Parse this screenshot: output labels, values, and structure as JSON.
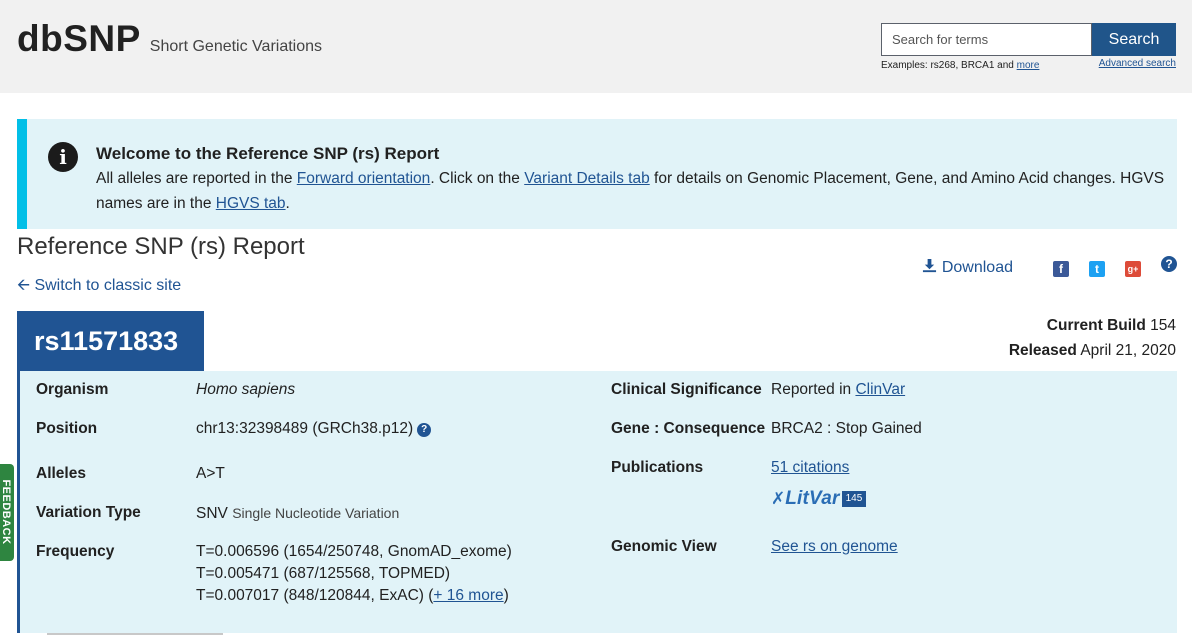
{
  "header": {
    "title": "dbSNP",
    "subtitle": "Short Genetic Variations",
    "search_placeholder": "Search for terms",
    "search_button": "Search",
    "examples_prefix": "Examples: rs268, BRCA1 and ",
    "examples_more": "more",
    "advanced_search": "Advanced search"
  },
  "banner": {
    "title": "Welcome to the Reference SNP (rs) Report",
    "text_1": "All alleles are reported in the ",
    "link_forward": "Forward orientation",
    "text_2": ". Click on the ",
    "link_variant_details": "Variant Details tab",
    "text_3": " for details on Genomic Placement, Gene, and Amino Acid changes. HGVS names are in the ",
    "link_hgvs": "HGVS tab",
    "text_4": "."
  },
  "report": {
    "title": "Reference SNP (rs) Report",
    "switch_classic": "Switch to classic site",
    "download": "Download",
    "rs_id": "rs11571833",
    "current_build_label": "Current Build",
    "current_build_value": "154",
    "released_label": "Released",
    "released_value": "April 21, 2020"
  },
  "details": {
    "organism_label": "Organism",
    "organism_value": "Homo sapiens",
    "position_label": "Position",
    "position_value": "chr13:32398489 (GRCh38.p12)",
    "alleles_label": "Alleles",
    "alleles_value": "A>T",
    "variation_type_label": "Variation Type",
    "variation_type_code": "SNV",
    "variation_type_desc": "Single Nucleotide Variation",
    "frequency_label": "Frequency",
    "frequency_1": "T=0.006596 (1654/250748, GnomAD_exome)",
    "frequency_2": "T=0.005471 (687/125568, TOPMED)",
    "frequency_3_prefix": "T=0.007017 (848/120844, ExAC) (",
    "frequency_more": "+ 16 more",
    "frequency_3_suffix": ")",
    "clinical_label": "Clinical Significance",
    "clinical_prefix": "Reported in ",
    "clinical_link": "ClinVar",
    "gene_label": "Gene : Consequence",
    "gene_value": "BRCA2 : Stop Gained",
    "publications_label": "Publications",
    "publications_link": "51 citations",
    "litvar_logo": "LitVar",
    "litvar_count": "145",
    "genomic_view_label": "Genomic View",
    "genomic_view_link": "See rs on genome"
  },
  "feedback": "FEEDBACK",
  "colors": {
    "primary": "#205493",
    "banner_bg": "#e1f3f8",
    "banner_accent": "#02bfe7",
    "feedback": "#2e8540"
  }
}
